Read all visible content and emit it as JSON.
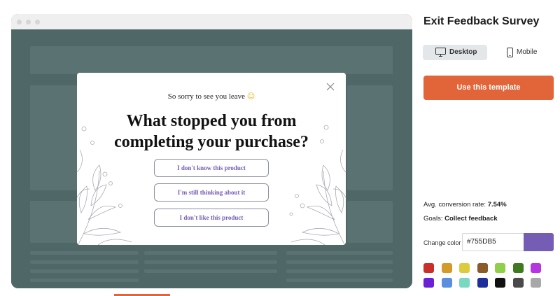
{
  "preview": {
    "modal": {
      "subtitle": "So sorry to see you leave",
      "emoji": "☺",
      "headline_line1": "What stopped you from",
      "headline_line2": "completing your purchase?",
      "options": [
        "I don't know this product",
        "I'm still thinking about it",
        "I don't like this product"
      ]
    }
  },
  "panel": {
    "title": "Exit Feedback Survey",
    "tabs": {
      "desktop": "Desktop",
      "mobile": "Mobile"
    },
    "cta": "Use this template",
    "conversion_label": "Avg. conversion rate:",
    "conversion_value": "7.54%",
    "goals_label": "Goals:",
    "goals_value": "Collect feedback",
    "change_color_label": "Change color",
    "color_value": "#755DB5"
  },
  "colors": {
    "accent": "#e2653a",
    "brand": "#755DB5",
    "palette_row1": [
      "#c9302c",
      "#d49a2a",
      "#dccb3c",
      "#8a5a2b",
      "#8fcf4a",
      "#3f7a1e",
      "#b535e0"
    ],
    "palette_row2": [
      "#6a21d6",
      "#5a8fe0",
      "#78d8c0",
      "#1e2f9a",
      "#111111",
      "#4a4a4a",
      "#a8a8a8"
    ]
  }
}
